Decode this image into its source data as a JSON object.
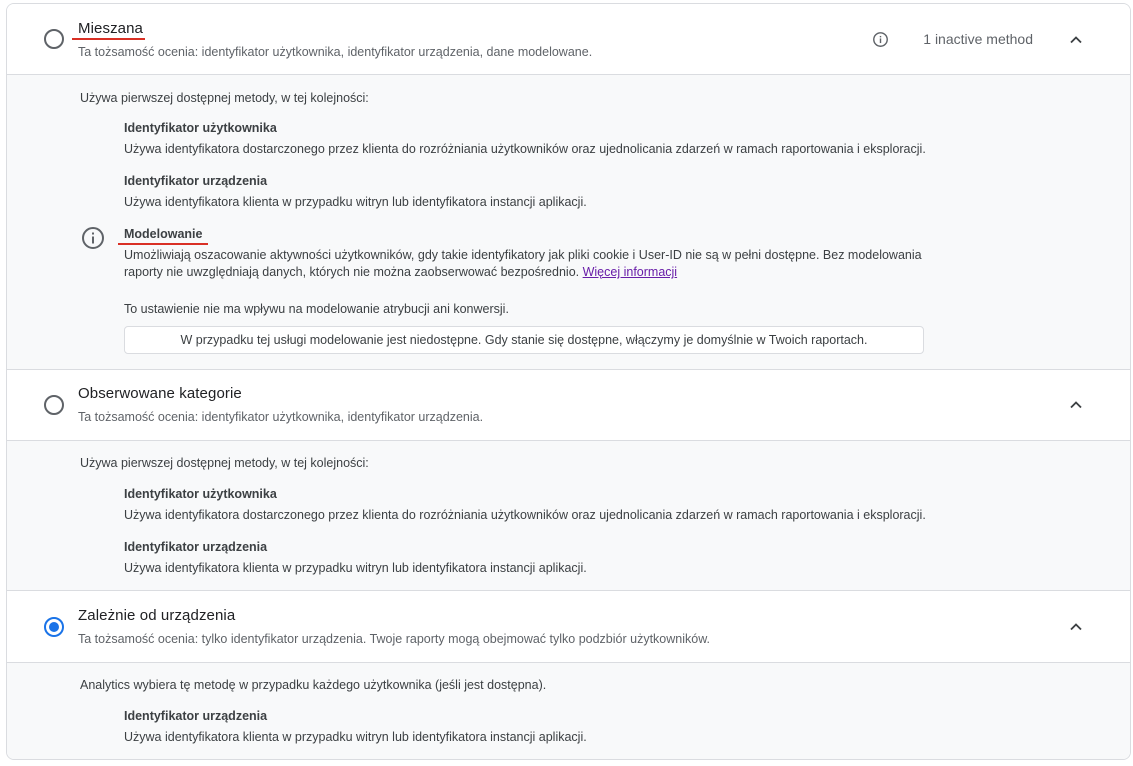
{
  "options": [
    {
      "title": "Mieszana",
      "subtitle": "Ta tożsamość ocenia: identyfikator użytkownika, identyfikator urządzenia, dane modelowane.",
      "status": "1 inactive method",
      "selected": false,
      "intro": "Używa pierwszej dostępnej metody, w tej kolejności:",
      "methods": [
        {
          "title": "Identyfikator użytkownika",
          "desc": "Używa identyfikatora dostarczonego przez klienta do rozróżniania użytkowników oraz ujednolicania zdarzeń w ramach raportowania i eksploracji."
        },
        {
          "title": "Identyfikator urządzenia",
          "desc": "Używa identyfikatora klienta w przypadku witryn lub identyfikatora instancji aplikacji."
        },
        {
          "title": "Modelowanie",
          "desc_line1": "Umożliwiają oszacowanie aktywności użytkowników, gdy takie identyfikatory jak pliki cookie i User-ID nie są w pełni dostępne. Bez modelowania",
          "desc_line2": "raporty nie uwzględniają danych, których nie można zaobserwować bezpośrednio.",
          "link": "Więcej informacji",
          "note": "To ustawienie nie ma wpływu na modelowanie atrybucji ani konwersji.",
          "notice": "W przypadku tej usługi modelowanie jest niedostępne. Gdy stanie się dostępne, włączymy je domyślnie w Twoich raportach."
        }
      ]
    },
    {
      "title": "Obserwowane kategorie",
      "subtitle": "Ta tożsamość ocenia: identyfikator użytkownika, identyfikator urządzenia.",
      "selected": false,
      "intro": "Używa pierwszej dostępnej metody, w tej kolejności:",
      "methods": [
        {
          "title": "Identyfikator użytkownika",
          "desc": "Używa identyfikatora dostarczonego przez klienta do rozróżniania użytkowników oraz ujednolicania zdarzeń w ramach raportowania i eksploracji."
        },
        {
          "title": "Identyfikator urządzenia",
          "desc": "Używa identyfikatora klienta w przypadku witryn lub identyfikatora instancji aplikacji."
        }
      ]
    },
    {
      "title": "Zależnie od urządzenia",
      "subtitle": "Ta tożsamość ocenia: tylko identyfikator urządzenia. Twoje raporty mogą obejmować tylko podzbiór użytkowników.",
      "selected": true,
      "intro": "Analytics wybiera tę metodę w przypadku każdego użytkownika (jeśli jest dostępna).",
      "methods": [
        {
          "title": "Identyfikator urządzenia",
          "desc": "Używa identyfikatora klienta w przypadku witryn lub identyfikatora instancji aplikacji."
        }
      ]
    }
  ],
  "colors": {
    "accent": "#1a73e8",
    "annotation": "#d93025",
    "link": "#681da8"
  },
  "icons": {
    "info": "info-icon",
    "collapse": "chevron-up-icon"
  }
}
